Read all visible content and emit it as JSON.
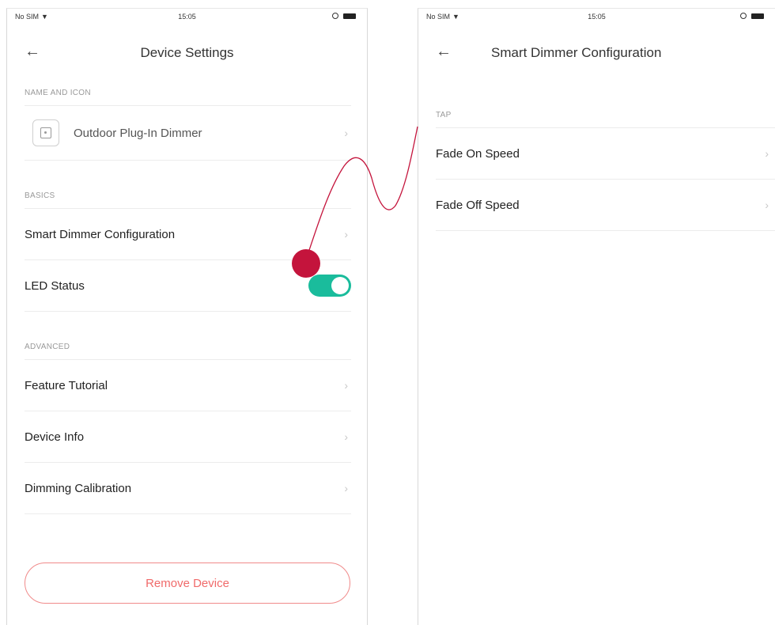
{
  "colors": {
    "accent_toggle": "#1abc9c",
    "remove_button": "#f06a6a",
    "tap_marker": "#c4143c",
    "connector_line": "#c4143c"
  },
  "left_screen": {
    "status_bar": {
      "carrier": "No SIM",
      "wifi_icon": "wifi-icon",
      "time": "15:05"
    },
    "nav": {
      "back_icon": "arrow-left-icon",
      "title": "Device Settings"
    },
    "sections": {
      "name_and_icon": {
        "header": "NAME AND ICON",
        "device_name": "Outdoor Plug-In Dimmer"
      },
      "basics": {
        "header": "BASICS",
        "smart_dimmer": "Smart Dimmer Configuration",
        "led_status": "LED Status",
        "led_status_on": true
      },
      "advanced": {
        "header": "ADVANCED",
        "feature_tutorial": "Feature Tutorial",
        "device_info": "Device Info",
        "dimming_calibration": "Dimming Calibration"
      }
    },
    "remove_button": "Remove Device"
  },
  "right_screen": {
    "status_bar": {
      "carrier": "No SIM",
      "time": "15:05"
    },
    "nav": {
      "back_icon": "arrow-left-icon",
      "title": "Smart Dimmer Configuration"
    },
    "section": {
      "header": "TAP",
      "fade_on": "Fade On Speed",
      "fade_off": "Fade Off Speed"
    }
  }
}
